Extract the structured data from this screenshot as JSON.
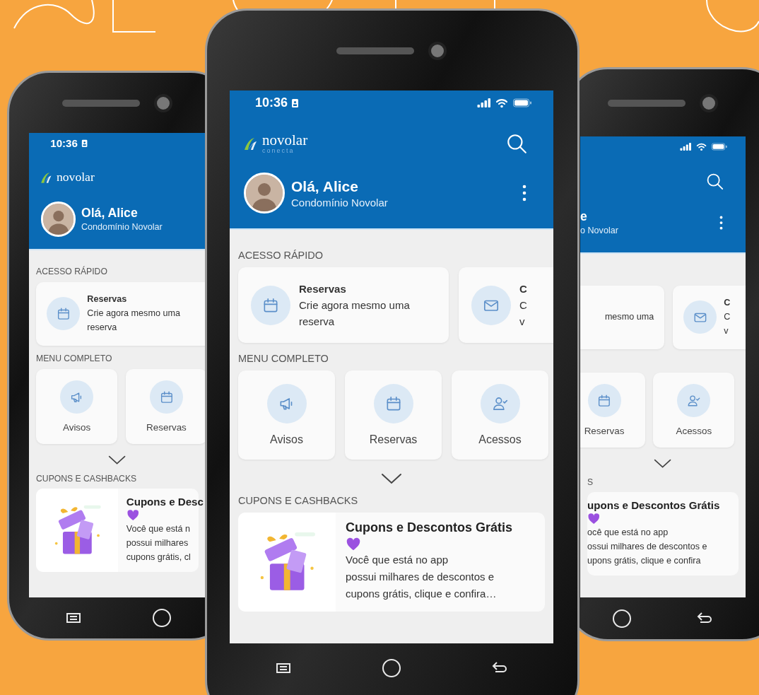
{
  "phones": [
    {
      "kind": "back-left",
      "status": {
        "time": "10:36"
      },
      "logo": {
        "name": "novolar"
      },
      "greeting": {
        "title": "Olá, Alice",
        "subtitle": "Condomínio Novolar"
      },
      "sections": [
        {
          "kind": "quick",
          "heading": "ACESSO RÁPIDO",
          "cards": [
            {
              "kind": "calendar",
              "title": "Reservas",
              "lines": [
                "Crie agora mesmo uma",
                "reserva"
              ]
            }
          ]
        },
        {
          "kind": "menu",
          "heading": "MENU COMPLETO",
          "items": [
            {
              "kind": "megaphone",
              "label": "Avisos"
            },
            {
              "kind": "calendar",
              "label": "Reservas"
            }
          ]
        },
        {
          "kind": "coupons",
          "heading": "CUPONS E CASHBACKS",
          "cards": [
            {
              "image": true,
              "title": "Cupons e Desc",
              "lines": [
                "Você que está n",
                "possui milhares",
                "cupons grátis, cl"
              ]
            }
          ]
        }
      ]
    },
    {
      "kind": "back-right",
      "greeting": {
        "title": "e",
        "subtitle": "o Novolar"
      },
      "sections": [
        {
          "kind": "quick",
          "cards": [
            {
              "kind": "plain",
              "lines": [
                "mesmo uma"
              ]
            },
            {
              "kind": "mail",
              "title": "C",
              "lines": [
                "C",
                "v"
              ]
            }
          ]
        },
        {
          "kind": "menu",
          "items": [
            {
              "kind": "calendar",
              "label": "Reservas"
            },
            {
              "kind": "person",
              "label": "Acessos"
            }
          ]
        },
        {
          "kind": "coupons",
          "heading": "S",
          "cards": [
            {
              "image": false,
              "title": "upons e Descontos Grátis",
              "lines": [
                "ocê que está no app",
                "ossui milhares de descontos e",
                "upons grátis, clique e confira"
              ]
            }
          ]
        }
      ]
    },
    {
      "kind": "front",
      "status": {
        "time": "10:36"
      },
      "logo": {
        "name": "novolar",
        "tagline": "conecta"
      },
      "greeting": {
        "title": "Olá, Alice",
        "subtitle": "Condomínio Novolar"
      },
      "sections": [
        {
          "kind": "quick",
          "heading": "ACESSO RÁPIDO",
          "cards": [
            {
              "kind": "calendar",
              "title": "Reservas",
              "lines": [
                "Crie agora mesmo uma",
                "reserva"
              ]
            },
            {
              "kind": "mail",
              "title": "C",
              "lines": [
                "C",
                "v"
              ]
            }
          ]
        },
        {
          "kind": "menu",
          "heading": "MENU COMPLETO",
          "items": [
            {
              "kind": "megaphone",
              "label": "Avisos"
            },
            {
              "kind": "calendar",
              "label": "Reservas"
            },
            {
              "kind": "person",
              "label": "Acessos"
            }
          ]
        },
        {
          "kind": "coupons",
          "heading": "CUPONS E CASHBACKS",
          "cards": [
            {
              "image": true,
              "title": "Cupons e Descontos Grátis",
              "lines": [
                "Você que está no app",
                "possui milhares de descontos e",
                "cupons grátis, clique e confira…"
              ]
            }
          ]
        }
      ]
    }
  ]
}
